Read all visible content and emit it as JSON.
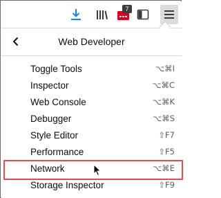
{
  "toolbar": {
    "extension_badge": "7",
    "icons": [
      "download-icon",
      "library-icon",
      "extension-icon",
      "sidebar-icon",
      "hamburger-menu-icon"
    ],
    "accent_color": "#0a84ff",
    "extension_color": "#d70022"
  },
  "panel": {
    "title": "Web Developer",
    "items": [
      {
        "label": "Toggle Tools",
        "shortcut": "⌥⌘I"
      },
      {
        "label": "Inspector",
        "shortcut": "⌥⌘C"
      },
      {
        "label": "Web Console",
        "shortcut": "⌥⌘K"
      },
      {
        "label": "Debugger",
        "shortcut": "⌥⌘S"
      },
      {
        "label": "Style Editor",
        "shortcut": "⇧F7"
      },
      {
        "label": "Performance",
        "shortcut": "⇧F5"
      },
      {
        "label": "Network",
        "shortcut": "⌥⌘E"
      },
      {
        "label": "Storage Inspector",
        "shortcut": "⇧F9"
      }
    ],
    "highlight_color": "#e84a4a"
  }
}
